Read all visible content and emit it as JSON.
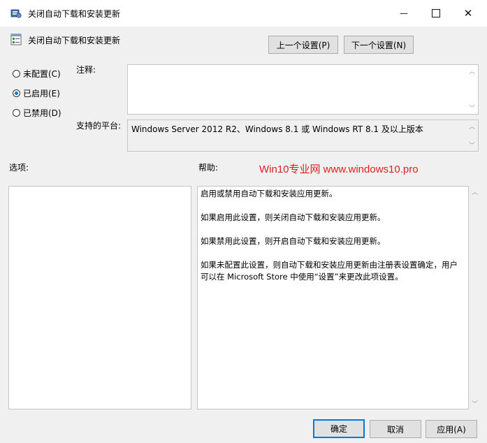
{
  "window": {
    "title": "关闭自动下载和安装更新",
    "minimize_glyph": "—",
    "maximize_glyph": "☐",
    "close_glyph": "✕"
  },
  "header": {
    "policy_title": "关闭自动下载和安装更新",
    "prev_button": "上一个设置(P)",
    "next_button": "下一个设置(N)"
  },
  "state": {
    "options": [
      {
        "label": "未配置(C)",
        "selected": false
      },
      {
        "label": "已启用(E)",
        "selected": true
      },
      {
        "label": "已禁用(D)",
        "selected": false
      }
    ]
  },
  "comment": {
    "label": "注释:",
    "value": ""
  },
  "platform": {
    "label": "支持的平台:",
    "value": "Windows Server 2012 R2、Windows 8.1 或 Windows RT 8.1 及以上版本"
  },
  "options_panel": {
    "label": "选项:"
  },
  "help_panel": {
    "label": "帮助:",
    "watermark": "Win10专业网 www.windows10.pro",
    "paragraphs": [
      "启用或禁用自动下载和安装应用更新。",
      "如果启用此设置，则关闭自动下载和安装应用更新。",
      "如果禁用此设置，则开启自动下载和安装应用更新。",
      "如果未配置此设置，则自动下载和安装应用更新由注册表设置确定，用户可以在 Microsoft Store 中使用“设置”来更改此项设置。"
    ]
  },
  "footer": {
    "ok": "确定",
    "cancel": "取消",
    "apply": "应用(A)"
  },
  "colors": {
    "accent": "#0078d7",
    "watermark": "#e02020",
    "background": "#f0f0f0"
  },
  "icons": {
    "window_icon": "group-policy-icon",
    "setting_icon": "policy-setting-icon"
  }
}
